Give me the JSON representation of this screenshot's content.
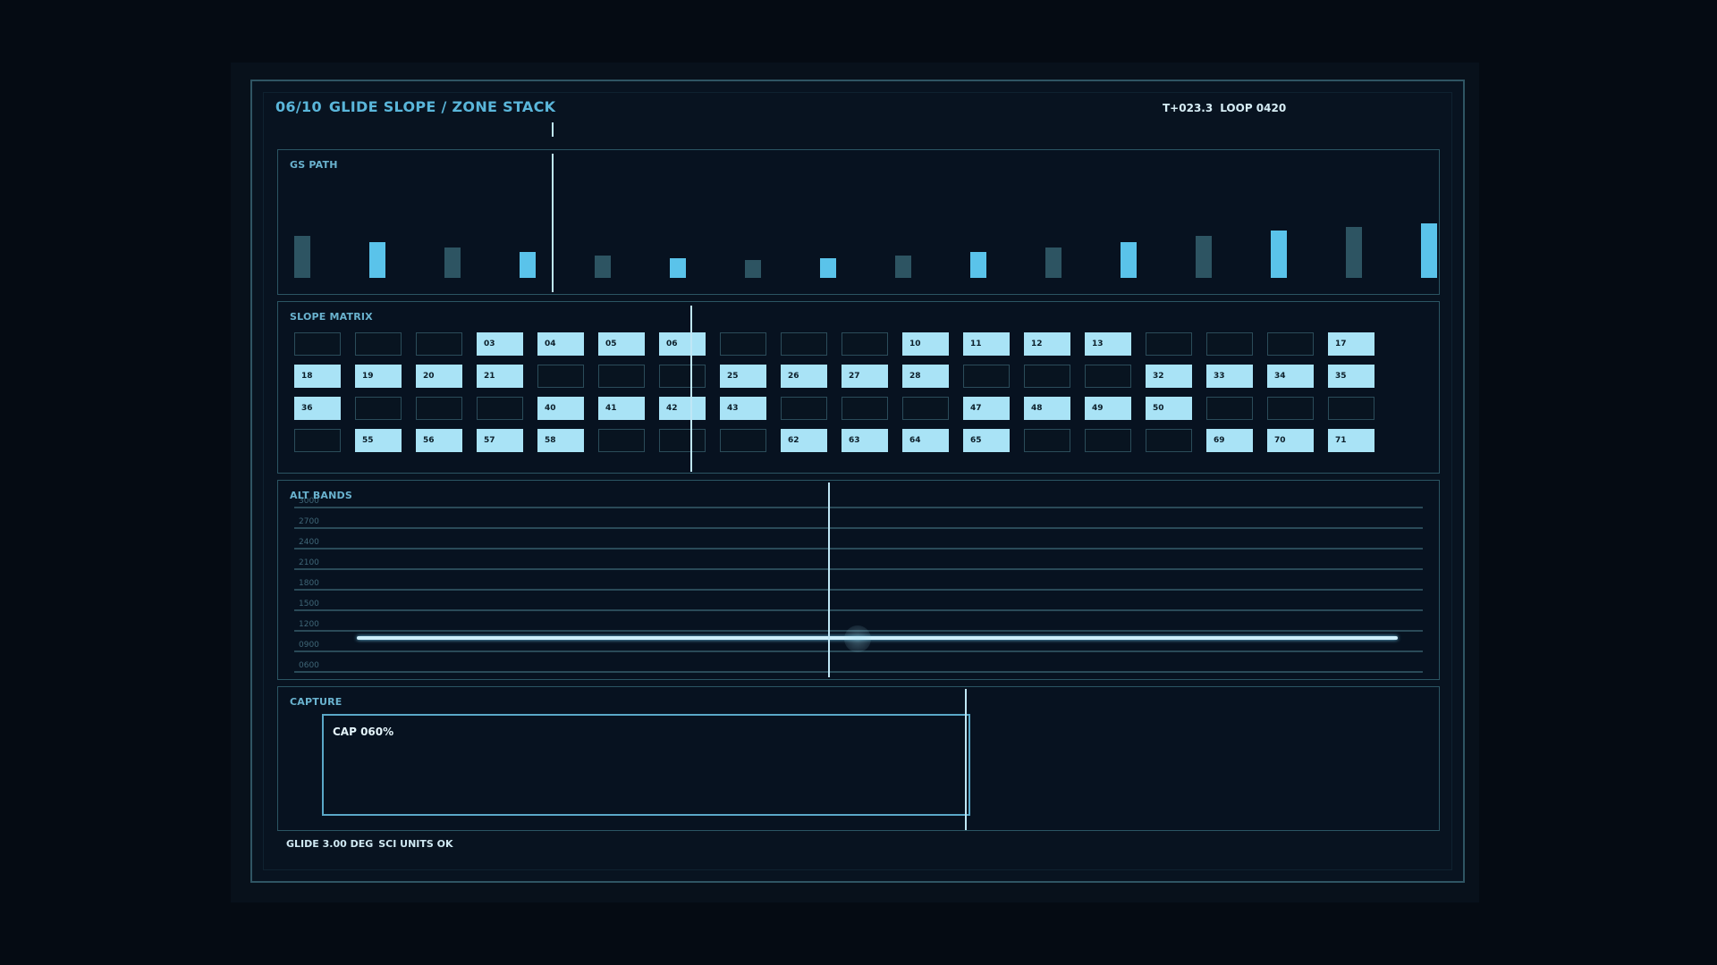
{
  "header": {
    "step": "06/10",
    "title": "GLIDE SLOPE / ZONE STACK",
    "time": "T+023.3",
    "loop": "LOOP 0420"
  },
  "gs_path": {
    "label": "GS PATH",
    "bars": [
      {
        "level": 0.47,
        "tone": "dark"
      },
      {
        "level": 0.4,
        "tone": "light"
      },
      {
        "level": 0.34,
        "tone": "dark"
      },
      {
        "level": 0.29,
        "tone": "light"
      },
      {
        "level": 0.25,
        "tone": "dark"
      },
      {
        "level": 0.22,
        "tone": "light"
      },
      {
        "level": 0.2,
        "tone": "dark"
      },
      {
        "level": 0.22,
        "tone": "light"
      },
      {
        "level": 0.25,
        "tone": "dark"
      },
      {
        "level": 0.29,
        "tone": "light"
      },
      {
        "level": 0.34,
        "tone": "dark"
      },
      {
        "level": 0.4,
        "tone": "light"
      },
      {
        "level": 0.47,
        "tone": "dark"
      },
      {
        "level": 0.53,
        "tone": "light"
      },
      {
        "level": 0.57,
        "tone": "dark"
      },
      {
        "level": 0.61,
        "tone": "light"
      }
    ]
  },
  "slope_matrix": {
    "label": "SLOPE MATRIX",
    "rows": [
      [
        "",
        "",
        "",
        "03",
        "04",
        "05",
        "06",
        "",
        "",
        "",
        "10",
        "11",
        "12",
        "13",
        "",
        "",
        "",
        "17"
      ],
      [
        "18",
        "19",
        "20",
        "21",
        "",
        "",
        "",
        "25",
        "26",
        "27",
        "28",
        "",
        "",
        "",
        "32",
        "33",
        "34",
        "35"
      ],
      [
        "36",
        "",
        "",
        "",
        "40",
        "41",
        "42",
        "43",
        "",
        "",
        "",
        "47",
        "48",
        "49",
        "50",
        "",
        "",
        ""
      ],
      [
        "",
        "55",
        "56",
        "57",
        "58",
        "",
        "",
        "",
        "62",
        "63",
        "64",
        "65",
        "",
        "",
        "",
        "69",
        "70",
        "71"
      ]
    ]
  },
  "alt_bands": {
    "label": "ALT BANDS",
    "levels": [
      "3000",
      "2700",
      "2400",
      "2100",
      "1800",
      "1500",
      "1200",
      "0900",
      "0600"
    ]
  },
  "capture": {
    "label": "CAPTURE",
    "text": "CAP 060%",
    "progress": 0.6
  },
  "footer": {
    "glide": "GLIDE 3.00 DEG",
    "status": "SCI UNITS OK"
  },
  "colors": {
    "accent": "#5ab6da",
    "bar_light": "#5ac3ea",
    "bar_dark": "#2d5462",
    "cell_on": "#a9e3f6"
  }
}
